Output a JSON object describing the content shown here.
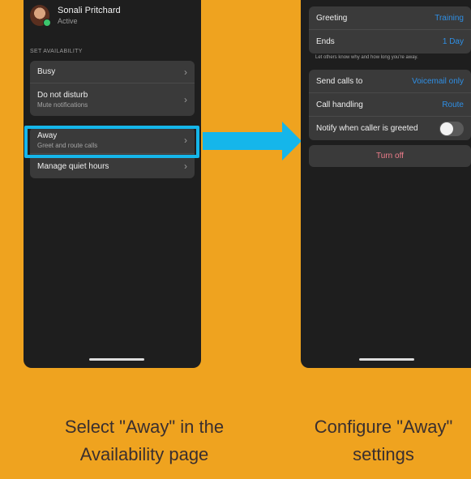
{
  "left_phone": {
    "profile": {
      "name": "Sonali Pritchard",
      "status": "Active"
    },
    "section_label": "SET AVAILABILITY",
    "status_items": [
      {
        "label": "Busy"
      },
      {
        "label": "Do not disturb",
        "sub": "Mute notifications"
      }
    ],
    "away_items": [
      {
        "label": "Away",
        "sub": "Greet and route calls"
      },
      {
        "label": "Manage quiet hours"
      }
    ]
  },
  "right_phone": {
    "greeting": {
      "label": "Greeting",
      "value": "Training"
    },
    "ends": {
      "label": "Ends",
      "value": "1 Day"
    },
    "hint": "Let others know why and how long you're away.",
    "send_calls": {
      "label": "Send calls to",
      "value": "Voicemail only"
    },
    "call_handling": {
      "label": "Call handling",
      "value": "Route"
    },
    "notify": {
      "label": "Notify when caller is greeted",
      "enabled": false
    },
    "turn_off": "Turn off"
  },
  "captions": {
    "left": [
      "Select \"Away\" in the",
      "Availability page"
    ],
    "right": [
      "Configure \"Away\"",
      "settings"
    ]
  },
  "colors": {
    "background": "#efa31f",
    "highlight": "#15b6ea",
    "link": "#2f8fe5",
    "turn_off": "#f07e8c"
  }
}
